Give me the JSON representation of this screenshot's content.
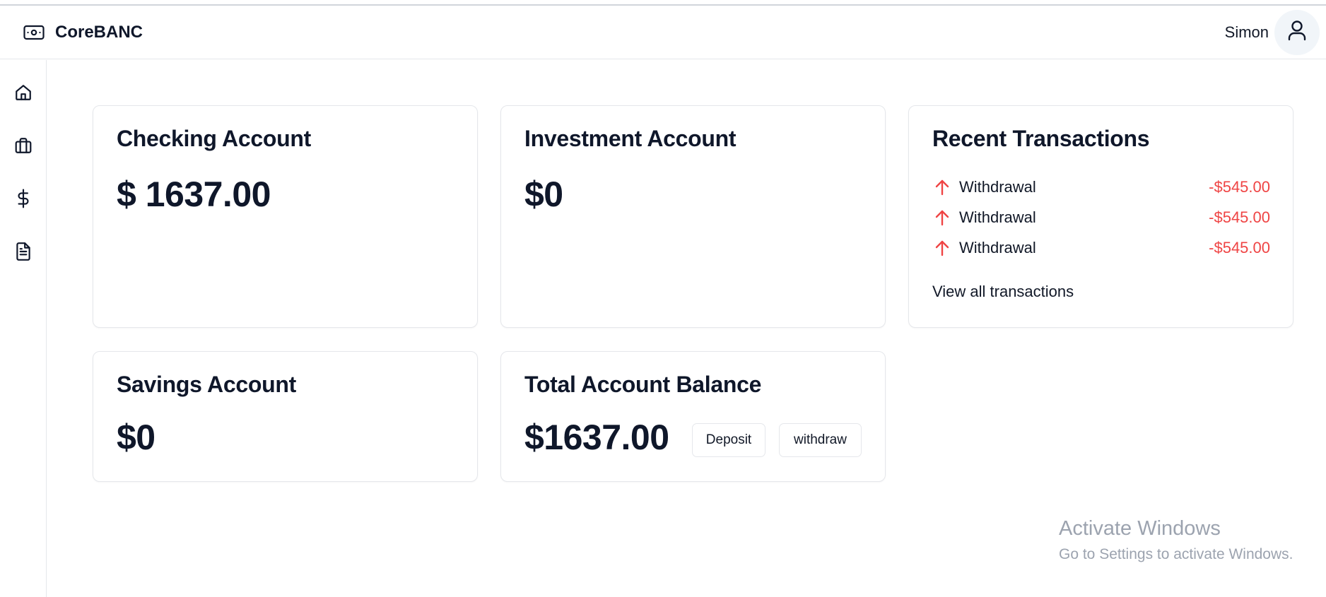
{
  "app": {
    "brand": "CoreBANC",
    "brand_icon": "banknote-icon"
  },
  "header": {
    "user_name": "Simon",
    "avatar_icon": "user-icon"
  },
  "sidebar": {
    "items": [
      {
        "name": "home",
        "icon": "home-icon"
      },
      {
        "name": "briefcase",
        "icon": "briefcase-icon"
      },
      {
        "name": "dollar",
        "icon": "dollar-sign-icon"
      },
      {
        "name": "documents",
        "icon": "file-text-icon"
      }
    ]
  },
  "checking": {
    "title": "Checking Account",
    "balance": "$ 1637.00"
  },
  "investment": {
    "title": "Investment Account",
    "balance": "$0"
  },
  "savings": {
    "title": "Savings Account",
    "balance": "$0"
  },
  "total": {
    "title": "Total Account Balance",
    "balance": "$1637.00",
    "deposit_label": "Deposit",
    "withdraw_label": "withdraw"
  },
  "transactions": {
    "title": "Recent Transactions",
    "items": [
      {
        "label": "Withdrawal",
        "amount": "-$545.00",
        "icon": "arrow-up-icon"
      },
      {
        "label": "Withdrawal",
        "amount": "-$545.00",
        "icon": "arrow-up-icon"
      },
      {
        "label": "Withdrawal",
        "amount": "-$545.00",
        "icon": "arrow-up-icon"
      }
    ],
    "view_all": "View all transactions"
  },
  "watermark": {
    "title": "Activate Windows",
    "subtitle": "Go to Settings to activate Windows."
  },
  "colors": {
    "text": "#0f172a",
    "negative": "#ef4444",
    "border": "#e5e7eb",
    "avatar_bg": "#f1f5f9",
    "watermark": "#9ca3af"
  }
}
